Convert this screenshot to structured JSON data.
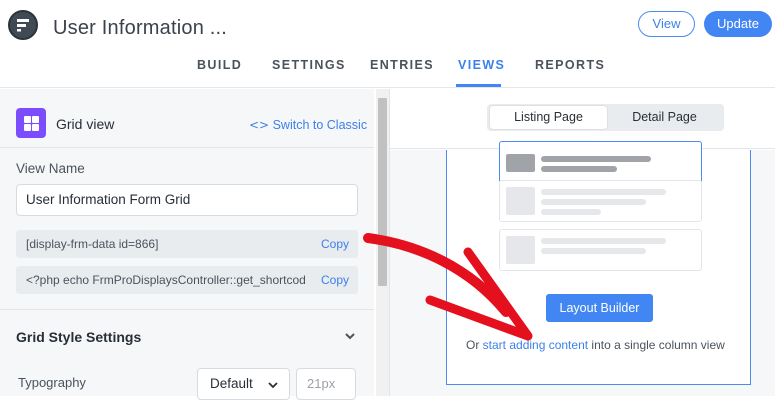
{
  "header": {
    "title": "User Information ...",
    "view_button": "View",
    "update_button": "Update"
  },
  "tabs": [
    {
      "label": "BUILD"
    },
    {
      "label": "SETTINGS"
    },
    {
      "label": "ENTRIES"
    },
    {
      "label": "VIEWS",
      "active": true
    },
    {
      "label": "REPORTS"
    }
  ],
  "sidebar": {
    "view_type": "Grid view",
    "switch_link": "Switch to Classic",
    "view_name_label": "View Name",
    "view_name_value": "User Information Form Grid",
    "shortcode_1": "[display-frm-data id=866]",
    "shortcode_2": "<?php echo FrmProDisplaysController::get_shortcod",
    "copy_label": "Copy",
    "grid_style_title": "Grid Style Settings",
    "typography_label": "Typography",
    "typography_select": "Default",
    "font_size_placeholder": "21px"
  },
  "preview": {
    "seg_listing": "Listing Page",
    "seg_detail": "Detail Page",
    "layout_builder_button": "Layout Builder",
    "or_text_pre": "Or ",
    "or_link": "start adding content",
    "or_text_post": " into a single column view"
  },
  "colors": {
    "accent": "#4286f4",
    "grid_icon": "#7c4dff",
    "annotation_arrow": "#e5101d"
  }
}
